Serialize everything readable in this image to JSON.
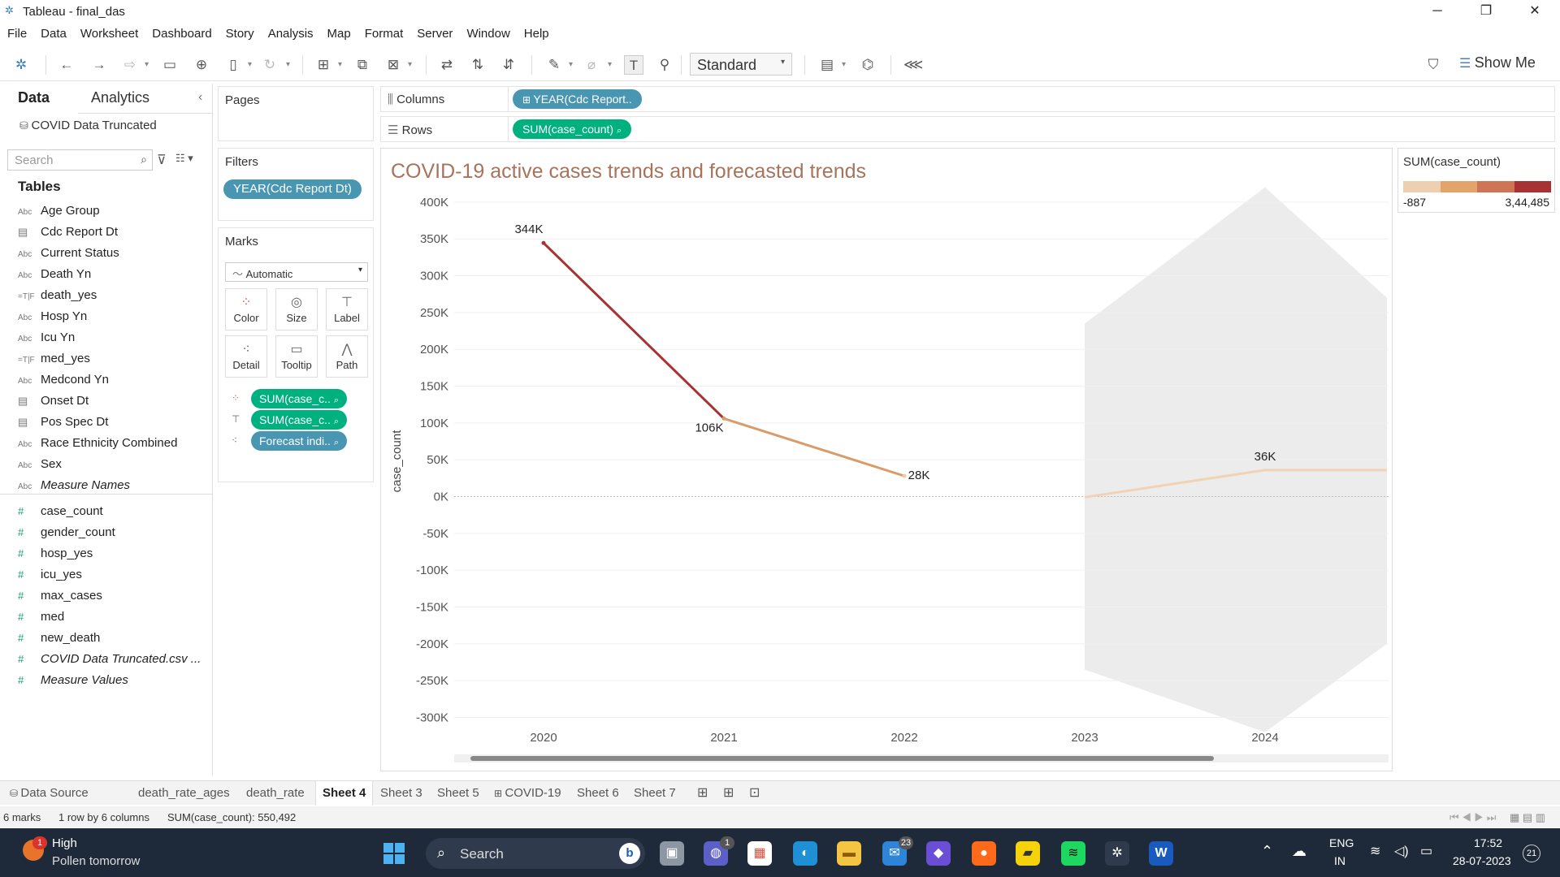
{
  "window": {
    "title": "Tableau - final_das",
    "minimize": "─",
    "restore": "❐",
    "close": "✕"
  },
  "menu": [
    "File",
    "Data",
    "Worksheet",
    "Dashboard",
    "Story",
    "Analysis",
    "Map",
    "Format",
    "Server",
    "Window",
    "Help"
  ],
  "toolbar": {
    "fit_mode": "Standard",
    "show_me": "Show Me"
  },
  "data_pane": {
    "tabs": [
      "Data",
      "Analytics"
    ],
    "source": "COVID Data Truncated",
    "search_placeholder": "Search",
    "tables_heading": "Tables",
    "dimensions": [
      {
        "type": "Abc",
        "name": "Age Group"
      },
      {
        "type": "date",
        "name": "Cdc Report Dt"
      },
      {
        "type": "Abc",
        "name": "Current Status"
      },
      {
        "type": "Abc",
        "name": "Death Yn"
      },
      {
        "type": "=T|F",
        "name": "death_yes"
      },
      {
        "type": "Abc",
        "name": "Hosp Yn"
      },
      {
        "type": "Abc",
        "name": "Icu Yn"
      },
      {
        "type": "=T|F",
        "name": "med_yes"
      },
      {
        "type": "Abc",
        "name": "Medcond Yn"
      },
      {
        "type": "date",
        "name": "Onset Dt"
      },
      {
        "type": "date",
        "name": "Pos Spec Dt"
      },
      {
        "type": "Abc",
        "name": "Race Ethnicity Combined"
      },
      {
        "type": "Abc",
        "name": "Sex"
      },
      {
        "type": "Abc",
        "name": "Measure Names",
        "italic": true
      }
    ],
    "measures": [
      {
        "name": "case_count"
      },
      {
        "name": "gender_count"
      },
      {
        "name": "hosp_yes"
      },
      {
        "name": "icu_yes"
      },
      {
        "name": "max_cases"
      },
      {
        "name": "med"
      },
      {
        "name": "new_death"
      },
      {
        "name": "COVID Data Truncated.csv ...",
        "italic": true
      },
      {
        "name": "Measure Values",
        "italic": true
      }
    ]
  },
  "pages": {
    "title": "Pages"
  },
  "filters": {
    "title": "Filters",
    "pills": [
      "YEAR(Cdc Report Dt)"
    ]
  },
  "marks": {
    "title": "Marks",
    "type": "Automatic",
    "buttons": [
      "Color",
      "Size",
      "Label",
      "Detail",
      "Tooltip",
      "Path"
    ],
    "pills": [
      "SUM(case_c..",
      "SUM(case_c..",
      "Forecast indi.."
    ]
  },
  "shelves": {
    "columns_label": "Columns",
    "columns_pill": "YEAR(Cdc Report..",
    "rows_label": "Rows",
    "rows_pill": "SUM(case_count)"
  },
  "legend": {
    "title": "SUM(case_count)",
    "min": "-887",
    "max": "3,44,485",
    "colors": [
      "#eed0b0",
      "#e2a46a",
      "#cf7455",
      "#a83232"
    ]
  },
  "chart_data": {
    "type": "line",
    "title": "COVID-19 active cases trends and forecasted trends",
    "ylabel": "case_count",
    "xlabel": "",
    "ylim": [
      -300000,
      400000
    ],
    "yticks": [
      400000,
      350000,
      300000,
      250000,
      200000,
      150000,
      100000,
      50000,
      0,
      -50000,
      -100000,
      -150000,
      -200000,
      -250000,
      -300000
    ],
    "ytick_labels": [
      "400K",
      "350K",
      "300K",
      "250K",
      "200K",
      "150K",
      "100K",
      "50K",
      "0K",
      "-50K",
      "-100K",
      "-150K",
      "-200K",
      "-250K",
      "-300K"
    ],
    "x_labels": [
      "2020",
      "2021",
      "2022",
      "2023",
      "2024"
    ],
    "actual": [
      {
        "x": 2020,
        "y": 344485,
        "label": "344K",
        "color": "#a83232"
      },
      {
        "x": 2021,
        "y": 106000,
        "label": "106K",
        "color": "#d99b67"
      },
      {
        "x": 2022,
        "y": 28000,
        "label": "28K",
        "color": "#efc9a0"
      }
    ],
    "forecast": [
      {
        "x": 2023,
        "y": -887,
        "label": ""
      },
      {
        "x": 2024,
        "y": 36000,
        "label": "36K"
      },
      {
        "x": 2025,
        "y": 36000,
        "label": ""
      }
    ],
    "forecast_band_upper": [
      [
        2023,
        235000
      ],
      [
        2024,
        420000
      ],
      [
        2025,
        270000
      ]
    ],
    "forecast_band_lower": [
      [
        2023,
        -235000
      ],
      [
        2024,
        -320000
      ],
      [
        2025,
        -200000
      ]
    ],
    "grid": true
  },
  "sheet_tabs": [
    "Data Source",
    "death_rate_ages",
    "death_rate",
    "Sheet 4",
    "Sheet 3",
    "Sheet 5",
    "COVID-19",
    "Sheet 6",
    "Sheet 7"
  ],
  "active_sheet": "Sheet 4",
  "status": {
    "marks": "6 marks",
    "dims": "1 row by 6 columns",
    "sum": "SUM(case_count): 550,492"
  },
  "taskbar": {
    "weather_title": "High",
    "weather_sub": "Pollen tomorrow",
    "weather_badge": "1",
    "search": "Search",
    "teams_badge": "1",
    "mail_badge": "23",
    "lang1": "ENG",
    "lang2": "IN",
    "time": "17:52",
    "date": "28-07-2023",
    "notif": "21"
  }
}
